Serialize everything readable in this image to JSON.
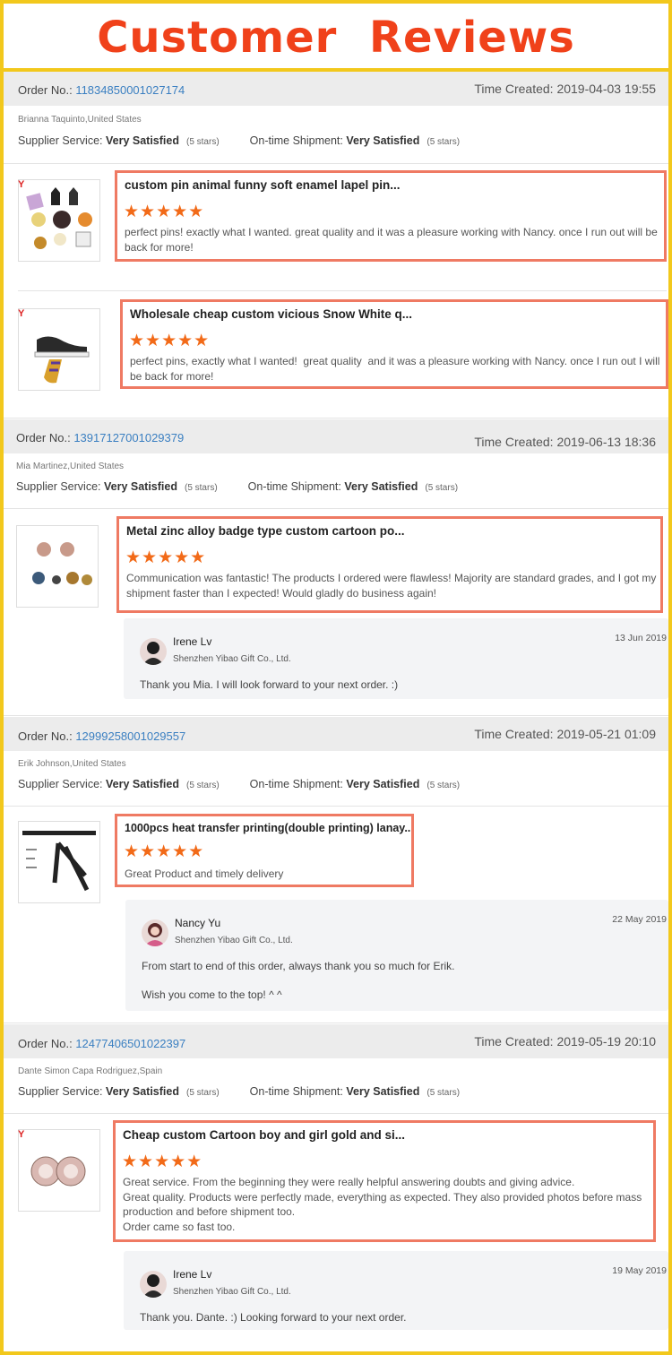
{
  "banner": {
    "title": "Customer  Reviews"
  },
  "labels": {
    "order_no": "Order No.:",
    "time_created": "Time Created:",
    "supplier_service": "Supplier Service:",
    "ontime_shipment": "On-time Shipment:"
  },
  "orders": [
    {
      "number": "11834850001027174",
      "created": "2019-04-03 19:55",
      "buyer": "Brianna Taquinto,United States",
      "supplier_rating": "Very Satisfied",
      "supplier_stars": "(5 stars)",
      "shipment_rating": "Very Satisfied",
      "shipment_stars": "(5 stars)",
      "reviews": [
        {
          "title": "custom pin animal funny soft enamel lapel pin...",
          "stars": "★★★★★",
          "text": "perfect pins! exactly what I wanted. great quality and it was a pleasure working with Nancy. once I run out will be back for more!"
        },
        {
          "title": "Wholesale cheap custom vicious Snow White q...",
          "stars": "★★★★★",
          "text": "perfect pins, exactly what I wanted!  great quality  and it was a pleasure working with Nancy. once I run out I will be back for more!"
        }
      ]
    },
    {
      "number": "13917127001029379",
      "created": "2019-06-13 18:36",
      "buyer": "Mia Martinez,United States",
      "supplier_rating": "Very Satisfied",
      "supplier_stars": "(5 stars)",
      "shipment_rating": "Very Satisfied",
      "shipment_stars": "(5 stars)",
      "reviews": [
        {
          "title": "Metal zinc alloy badge type custom cartoon po...",
          "stars": "★★★★★",
          "text": "Communication was fantastic! The products I ordered were flawless! Majority are standard grades, and I got my shipment faster than I expected! Would gladly do business again!"
        }
      ],
      "reply": {
        "name": "Irene Lv",
        "company": "Shenzhen Yibao Gift Co., Ltd.",
        "date": "13 Jun 2019",
        "message": "Thank you Mia. I will look forward to your next order. :)"
      }
    },
    {
      "number": "12999258001029557",
      "created": "2019-05-21 01:09",
      "buyer": "Erik Johnson,United States",
      "supplier_rating": "Very Satisfied",
      "supplier_stars": "(5 stars)",
      "shipment_rating": "Very Satisfied",
      "shipment_stars": "(5 stars)",
      "reviews": [
        {
          "title": "1000pcs heat transfer printing(double printing) lanay...",
          "stars": "★★★★★",
          "text": "Great Product and timely delivery"
        }
      ],
      "reply": {
        "name": "Nancy Yu",
        "company": "Shenzhen Yibao Gift Co., Ltd.",
        "date": "22 May 2019",
        "message": "From start to end of this order, always thank you so much for Erik.\n\nWish you come to the top! ^ ^"
      }
    },
    {
      "number": "12477406501022397",
      "created": "2019-05-19 20:10",
      "buyer": "Dante Simon Capa Rodriguez,Spain",
      "supplier_rating": "Very Satisfied",
      "supplier_stars": "(5 stars)",
      "shipment_rating": "Very Satisfied",
      "shipment_stars": "(5 stars)",
      "reviews": [
        {
          "title": "Cheap custom Cartoon boy and girl gold and si...",
          "stars": "★★★★★",
          "text": "Great service. From the beginning they were really helpful answering doubts and giving advice.\nGreat quality. Products were perfectly made, everything as expected. They also provided photos before mass production and before shipment too.\nOrder came so fast too."
        }
      ],
      "reply": {
        "name": "Irene Lv",
        "company": "Shenzhen Yibao Gift Co., Ltd.",
        "date": "19 May 2019",
        "message": "Thank you. Dante. :) Looking forward to your next order."
      }
    }
  ]
}
